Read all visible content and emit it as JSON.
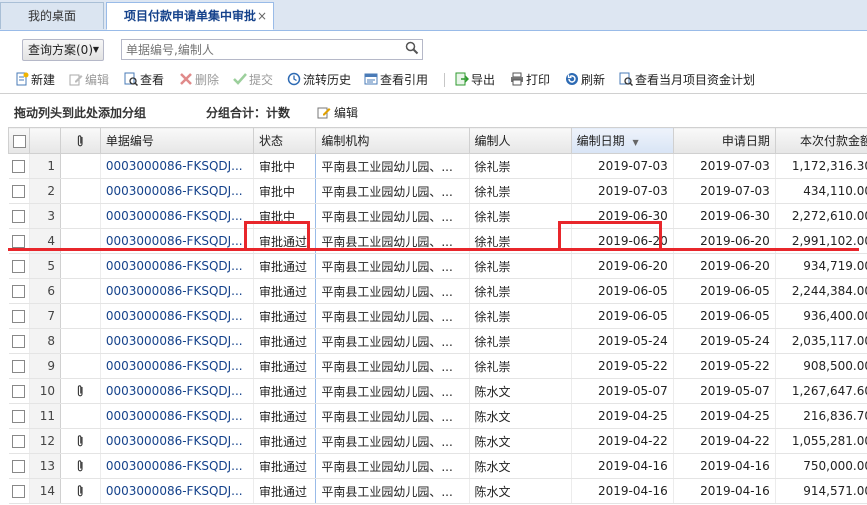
{
  "tabs": [
    {
      "label": "我的桌面"
    },
    {
      "label": "项目付款申请单集中审批",
      "close": "×"
    }
  ],
  "query": {
    "scheme_label": "查询方案(0)",
    "search_placeholder": "单据编号,编制人"
  },
  "toolbar": {
    "new": "新建",
    "edit": "编辑",
    "view": "查看",
    "delete": "删除",
    "submit": "提交",
    "flow_history": "流转历史",
    "view_ref": "查看引用",
    "export": "导出",
    "print": "打印",
    "refresh": "刷新",
    "monthly_plan": "查看当月项目资金计划"
  },
  "groupbar": {
    "hint": "拖动列头到此处添加分组",
    "sum": "分组合计：计数",
    "edit": "编辑"
  },
  "columns": [
    "单据编号",
    "状态",
    "编制机构",
    "编制人",
    "编制日期",
    "申请日期",
    "本次付款金额"
  ],
  "rows": [
    {
      "n": "1",
      "clip": false,
      "no": "0003000086-FKSQDJ...",
      "status": "审批中",
      "org": "平南县工业园幼儿园、...",
      "person": "徐礼崇",
      "made": "2019-07-03",
      "apply": "2019-07-03",
      "amount": "1,172,316.30"
    },
    {
      "n": "2",
      "clip": false,
      "no": "0003000086-FKSQDJ...",
      "status": "审批中",
      "org": "平南县工业园幼儿园、...",
      "person": "徐礼崇",
      "made": "2019-07-03",
      "apply": "2019-07-03",
      "amount": "434,110.00"
    },
    {
      "n": "3",
      "clip": false,
      "no": "0003000086-FKSQDJ...",
      "status": "审批中",
      "org": "平南县工业园幼儿园、...",
      "person": "徐礼崇",
      "made": "2019-06-30",
      "apply": "2019-06-30",
      "amount": "2,272,610.00"
    },
    {
      "n": "4",
      "clip": false,
      "no": "0003000086-FKSQDJ...",
      "status": "审批通过",
      "org": "平南县工业园幼儿园、...",
      "person": "徐礼崇",
      "made": "2019-06-20",
      "apply": "2019-06-20",
      "amount": "2,991,102.00"
    },
    {
      "n": "5",
      "clip": false,
      "no": "0003000086-FKSQDJ...",
      "status": "审批通过",
      "org": "平南县工业园幼儿园、...",
      "person": "徐礼崇",
      "made": "2019-06-20",
      "apply": "2019-06-20",
      "amount": "934,719.00"
    },
    {
      "n": "6",
      "clip": false,
      "no": "0003000086-FKSQDJ...",
      "status": "审批通过",
      "org": "平南县工业园幼儿园、...",
      "person": "徐礼崇",
      "made": "2019-06-05",
      "apply": "2019-06-05",
      "amount": "2,244,384.00"
    },
    {
      "n": "7",
      "clip": false,
      "no": "0003000086-FKSQDJ...",
      "status": "审批通过",
      "org": "平南县工业园幼儿园、...",
      "person": "徐礼崇",
      "made": "2019-06-05",
      "apply": "2019-06-05",
      "amount": "936,400.00"
    },
    {
      "n": "8",
      "clip": false,
      "no": "0003000086-FKSQDJ...",
      "status": "审批通过",
      "org": "平南县工业园幼儿园、...",
      "person": "徐礼崇",
      "made": "2019-05-24",
      "apply": "2019-05-24",
      "amount": "2,035,117.00"
    },
    {
      "n": "9",
      "clip": false,
      "no": "0003000086-FKSQDJ...",
      "status": "审批通过",
      "org": "平南县工业园幼儿园、...",
      "person": "徐礼崇",
      "made": "2019-05-22",
      "apply": "2019-05-22",
      "amount": "908,500.00"
    },
    {
      "n": "10",
      "clip": true,
      "no": "0003000086-FKSQDJ...",
      "status": "审批通过",
      "org": "平南县工业园幼儿园、...",
      "person": "陈水文",
      "made": "2019-05-07",
      "apply": "2019-05-07",
      "amount": "1,267,647.60"
    },
    {
      "n": "11",
      "clip": false,
      "no": "0003000086-FKSQDJ...",
      "status": "审批通过",
      "org": "平南县工业园幼儿园、...",
      "person": "陈水文",
      "made": "2019-04-25",
      "apply": "2019-04-25",
      "amount": "216,836.70"
    },
    {
      "n": "12",
      "clip": true,
      "no": "0003000086-FKSQDJ...",
      "status": "审批通过",
      "org": "平南县工业园幼儿园、...",
      "person": "陈水文",
      "made": "2019-04-22",
      "apply": "2019-04-22",
      "amount": "1,055,281.00"
    },
    {
      "n": "13",
      "clip": true,
      "no": "0003000086-FKSQDJ...",
      "status": "审批通过",
      "org": "平南县工业园幼儿园、...",
      "person": "陈水文",
      "made": "2019-04-16",
      "apply": "2019-04-16",
      "amount": "750,000.00"
    },
    {
      "n": "14",
      "clip": true,
      "no": "0003000086-FKSQDJ...",
      "status": "审批通过",
      "org": "平南县工业园幼儿园、...",
      "person": "陈水文",
      "made": "2019-04-16",
      "apply": "2019-04-16",
      "amount": "914,571.00"
    }
  ],
  "colors": {
    "link": "#15428b",
    "highlight": "#e8262b",
    "header_bg": "#dde6f2"
  }
}
